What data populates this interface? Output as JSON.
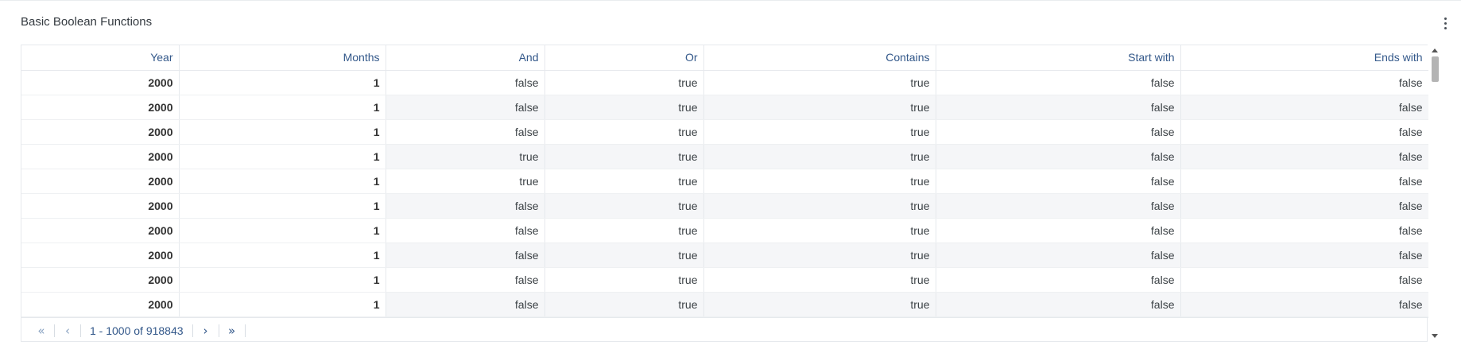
{
  "panel": {
    "title": "Basic Boolean Functions",
    "menu_icon": "kebab-vertical-icon"
  },
  "table": {
    "columns": [
      "Year",
      "Months",
      "And",
      "Or",
      "Contains",
      "Start with",
      "Ends with"
    ],
    "rows": [
      [
        "2000",
        "1",
        "false",
        "true",
        "true",
        "false",
        "false"
      ],
      [
        "2000",
        "1",
        "false",
        "true",
        "true",
        "false",
        "false"
      ],
      [
        "2000",
        "1",
        "false",
        "true",
        "true",
        "false",
        "false"
      ],
      [
        "2000",
        "1",
        "true",
        "true",
        "true",
        "false",
        "false"
      ],
      [
        "2000",
        "1",
        "true",
        "true",
        "true",
        "false",
        "false"
      ],
      [
        "2000",
        "1",
        "false",
        "true",
        "true",
        "false",
        "false"
      ],
      [
        "2000",
        "1",
        "false",
        "true",
        "true",
        "false",
        "false"
      ],
      [
        "2000",
        "1",
        "false",
        "true",
        "true",
        "false",
        "false"
      ],
      [
        "2000",
        "1",
        "false",
        "true",
        "true",
        "false",
        "false"
      ],
      [
        "2000",
        "1",
        "false",
        "true",
        "true",
        "false",
        "false"
      ]
    ]
  },
  "pagination": {
    "first_icon": "«",
    "prev_icon": "‹",
    "range_label": "1 - 1000 of 918843",
    "next_icon": "›",
    "last_icon": "»"
  },
  "colors": {
    "header_text": "#33588a",
    "border": "#e6e9ed",
    "striped_row": "#f5f6f8"
  }
}
